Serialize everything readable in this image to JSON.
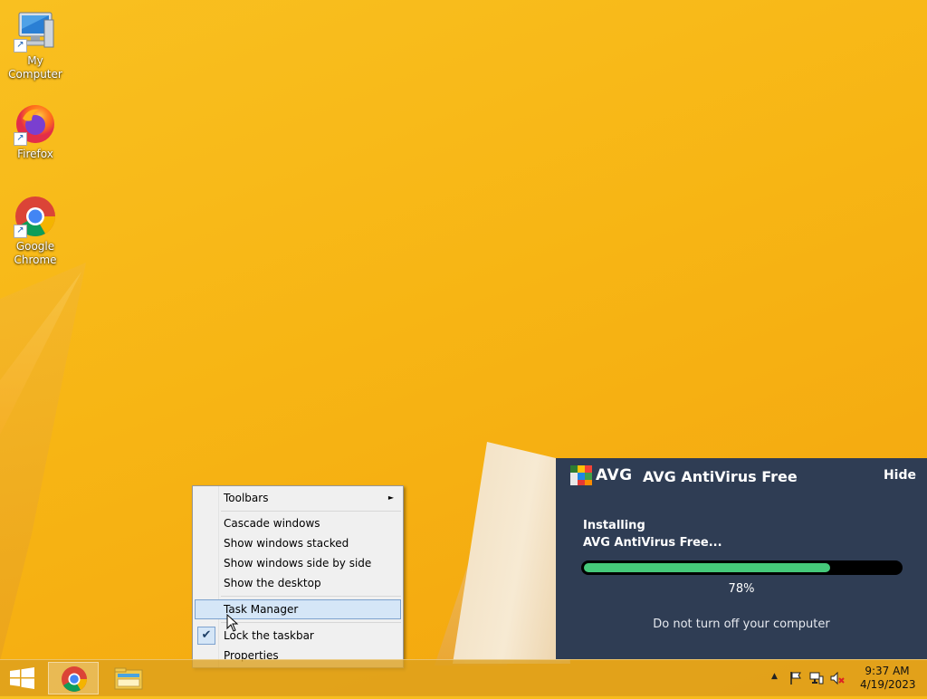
{
  "desktop": {
    "icons": [
      {
        "label": "My Computer",
        "icon": "computer-icon"
      },
      {
        "label": "Firefox",
        "icon": "firefox-icon"
      },
      {
        "label": "Google Chrome",
        "icon": "chrome-icon"
      }
    ]
  },
  "context_menu": {
    "items": {
      "toolbars": "Toolbars",
      "cascade": "Cascade windows",
      "stacked": "Show windows stacked",
      "side_by_side": "Show windows side by side",
      "show_desktop": "Show the desktop",
      "task_manager": "Task Manager",
      "lock_taskbar": "Lock the taskbar",
      "properties": "Properties"
    },
    "submenu_arrow": "►",
    "check_mark": "✔"
  },
  "avg": {
    "logo_text": "AVG",
    "title": "AVG AntiVirus Free",
    "hide_label": "Hide",
    "status_line1": "Installing",
    "status_line2": "AVG AntiVirus Free...",
    "progress_percent": 78,
    "progress_label": "78%",
    "note": "Do not turn off your computer",
    "accent_color": "#45c97a",
    "panel_color": "#2f3d54"
  },
  "taskbar": {
    "start_icon": "windows-logo-icon",
    "pinned": [
      "chrome-icon",
      "file-explorer-icon"
    ],
    "tray": {
      "show_hidden_icon": "▲",
      "icons": [
        "action-center-flag-icon",
        "network-icon",
        "volume-muted-icon"
      ]
    },
    "clock": {
      "time": "9:37 AM",
      "date": "4/19/2023"
    }
  }
}
